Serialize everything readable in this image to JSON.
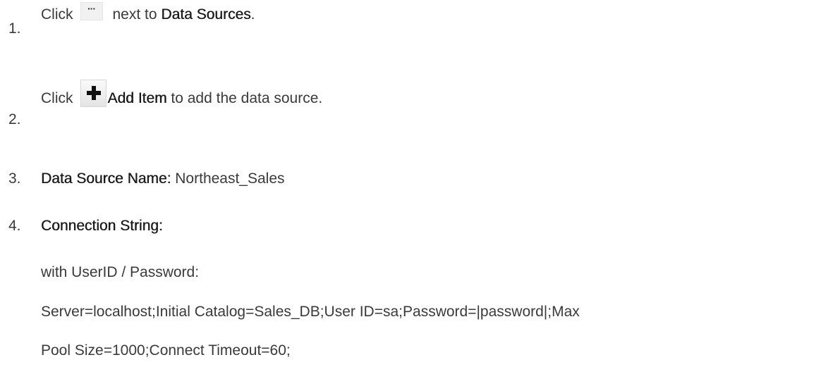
{
  "steps": [
    {
      "number": "1.",
      "prefix": "Click",
      "icon": "ellipsis-icon",
      "icon_glyph": "···",
      "middle": "next to",
      "target": "Data Sources",
      "suffix": "."
    },
    {
      "number": "2.",
      "prefix": "Click",
      "icon": "plus-icon",
      "target": "Add Item",
      "suffix": "to add the data source."
    },
    {
      "number": "3.",
      "label": "Data Source Name:",
      "value": "Northeast_Sales"
    },
    {
      "number": "4.",
      "label": "Connection String:",
      "lines": [
        "with UserID / Password:",
        "Server=localhost;Initial Catalog=Sales_DB;User ID=sa;Password=|password|;Max",
        "Pool Size=1000;Connect Timeout=60;"
      ]
    }
  ]
}
